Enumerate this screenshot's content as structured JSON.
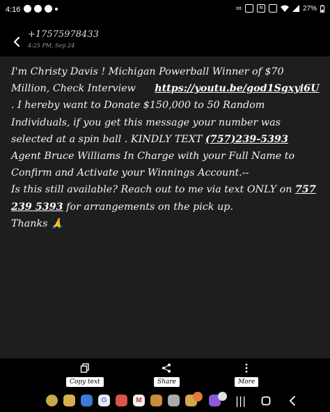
{
  "status_bar": {
    "time": "4:16",
    "battery": "27%"
  },
  "header": {
    "contact": "+17575978433",
    "timestamp": "4:25 PM, Sep 24"
  },
  "message": {
    "p1": "I'm Christy Davis ! Michigan Powerball Winner of $70 Million, Check Interview",
    "link1": "https://youtu.be/god1Sgxyi6U",
    "p2": ". I hereby want to Donate $150,000 to 50 Random Individuals, if you get this message your number was selected at a spin ball . KINDLY TEXT",
    "phone1": "(757)239-5393",
    "p3": "Agent Bruce Williams In Charge with your Full Name to Confirm and Activate your Winnings Account.--",
    "p4": "Is this still available? Reach out to me via text ONLY on",
    "phone2": "757 239 5393",
    "p5": "for arrangements on the pick up.",
    "p6": "Thanks 🙏"
  },
  "actions": {
    "copy": "Copy text",
    "share": "Share",
    "more": "More"
  },
  "icons": [
    "back-arrow-icon",
    "copy-icon",
    "share-icon",
    "more-icon",
    "home-icon",
    "recents-icon",
    "back-nav-icon"
  ]
}
